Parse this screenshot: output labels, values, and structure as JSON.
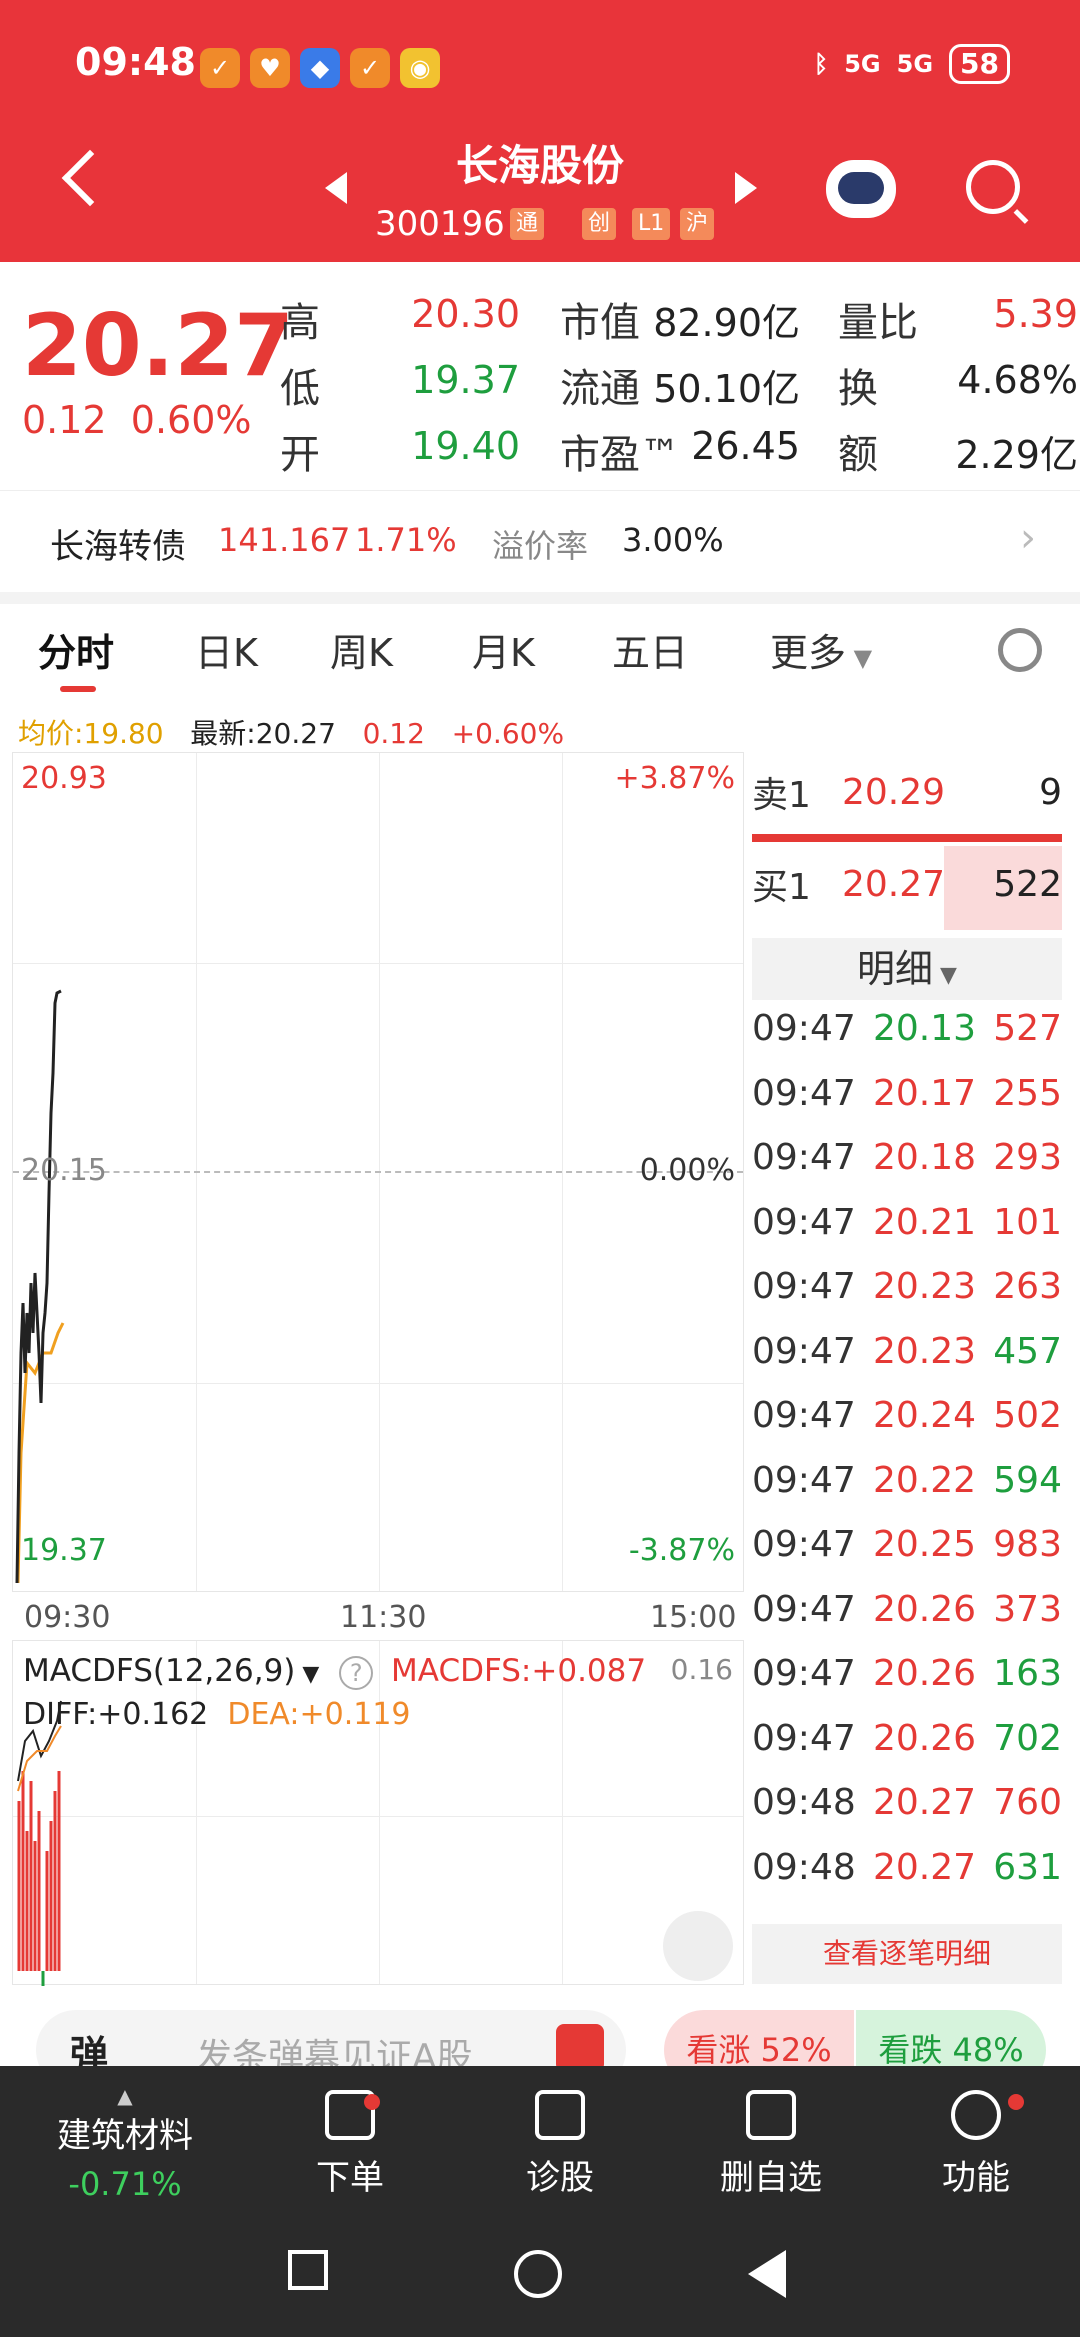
{
  "status": {
    "time": "09:48",
    "signal1": "5G",
    "signal2": "5G",
    "battery": "58"
  },
  "header": {
    "title": "长海股份",
    "code": "300196",
    "tags": [
      "通",
      "创",
      "L1",
      "沪"
    ]
  },
  "quote": {
    "price": "20.27",
    "change": "0.12",
    "change_pct": "0.60%",
    "rows": [
      [
        {
          "label": "高",
          "value": "20.30"
        },
        {
          "label": "市值",
          "value": "82.90亿"
        },
        {
          "label": "量比",
          "value": "5.39"
        }
      ],
      [
        {
          "label": "低",
          "value": "19.37"
        },
        {
          "label": "流通",
          "value": "50.10亿"
        },
        {
          "label": "换",
          "value": "4.68%"
        }
      ],
      [
        {
          "label": "开",
          "value": "19.40"
        },
        {
          "label": "市盈™",
          "value": "26.45"
        },
        {
          "label": "额",
          "value": "2.29亿"
        }
      ]
    ]
  },
  "bond": {
    "name": "长海转债",
    "price": "141.167",
    "pct": "1.71%",
    "premium_label": "溢价率",
    "premium": "3.00%"
  },
  "tabs": [
    "分时",
    "日K",
    "周K",
    "月K",
    "五日",
    "更多"
  ],
  "info": {
    "avg_label": "均价:19.80",
    "latest_label": "最新:20.27",
    "chg": "0.12",
    "pct": "+0.60%"
  },
  "chart": {
    "max": "20.93",
    "min": "19.37",
    "mid": "20.15",
    "max_pct": "+3.87%",
    "min_pct": "-3.87%",
    "mid_pct": "0.00%",
    "times": [
      "09:30",
      "11:30",
      "15:00"
    ],
    "colors": {
      "price": "#222222",
      "avg": "#f0a020"
    }
  },
  "macd": {
    "title": "MACDFS(12,26,9)",
    "value": "MACDFS:+0.087",
    "corner": "0.16",
    "diff": "DIFF:+0.162",
    "dea": "DEA:+0.119"
  },
  "orderbook": {
    "sell": {
      "label": "卖1",
      "price": "20.29",
      "vol": "9"
    },
    "buy": {
      "label": "买1",
      "price": "20.27",
      "vol": "522"
    },
    "detail_label": "明细",
    "more": "查看逐笔明细",
    "ticks": [
      {
        "t": "09:47",
        "p": "20.13",
        "v": "527",
        "pc": "green",
        "vc": "red"
      },
      {
        "t": "09:47",
        "p": "20.17",
        "v": "255",
        "pc": "red",
        "vc": "red"
      },
      {
        "t": "09:47",
        "p": "20.18",
        "v": "293",
        "pc": "red",
        "vc": "red"
      },
      {
        "t": "09:47",
        "p": "20.21",
        "v": "101",
        "pc": "red",
        "vc": "red"
      },
      {
        "t": "09:47",
        "p": "20.23",
        "v": "263",
        "pc": "red",
        "vc": "red"
      },
      {
        "t": "09:47",
        "p": "20.23",
        "v": "457",
        "pc": "red",
        "vc": "green"
      },
      {
        "t": "09:47",
        "p": "20.24",
        "v": "502",
        "pc": "red",
        "vc": "red"
      },
      {
        "t": "09:47",
        "p": "20.22",
        "v": "594",
        "pc": "red",
        "vc": "green"
      },
      {
        "t": "09:47",
        "p": "20.25",
        "v": "983",
        "pc": "red",
        "vc": "red"
      },
      {
        "t": "09:47",
        "p": "20.26",
        "v": "373",
        "pc": "red",
        "vc": "red"
      },
      {
        "t": "09:47",
        "p": "20.26",
        "v": "163",
        "pc": "red",
        "vc": "green"
      },
      {
        "t": "09:47",
        "p": "20.26",
        "v": "702",
        "pc": "red",
        "vc": "green"
      },
      {
        "t": "09:48",
        "p": "20.27",
        "v": "760",
        "pc": "red",
        "vc": "red"
      },
      {
        "t": "09:48",
        "p": "20.27",
        "v": "631",
        "pc": "red",
        "vc": "green"
      }
    ]
  },
  "danmu": {
    "icon": "弹",
    "placeholder": "发条弹幕见证A股",
    "up": "看涨 52%",
    "down": "看跌 48%"
  },
  "bottom": {
    "sector": "建筑材料",
    "sector_pct": "-0.71%",
    "items": [
      "下单",
      "诊股",
      "删自选",
      "功能"
    ]
  }
}
